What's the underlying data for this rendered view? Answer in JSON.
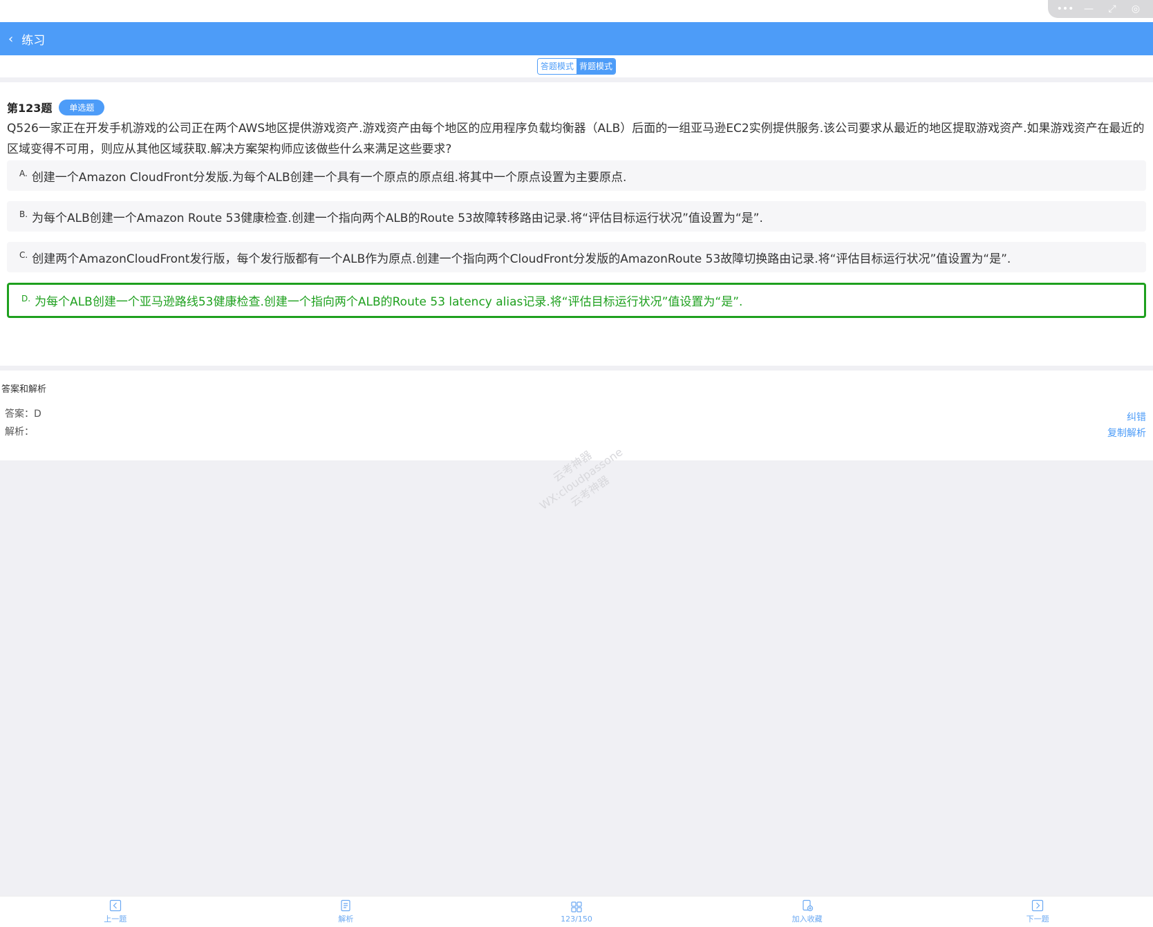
{
  "window_controls": {
    "more": "•••",
    "minimize": "—",
    "restore": "⤢",
    "close": "◎"
  },
  "navbar": {
    "back_icon": "‹",
    "title": "练习"
  },
  "modes": {
    "answer_mode": "答题模式",
    "memorize_mode": "背题模式",
    "active": "背题模式"
  },
  "question": {
    "number": "第123题",
    "type": "单选题",
    "text": "Q526一家正在开发手机游戏的公司正在两个AWS地区提供游戏资产.游戏资产由每个地区的应用程序负载均衡器（ALB）后面的一组亚马逊EC2实例提供服务.该公司要求从最近的地区提取游戏资产.如果游戏资产在最近的区域变得不可用，则应从其他区域获取.解决方案架构师应该做些什么来满足这些要求?",
    "options": [
      {
        "letter": "A.",
        "text": "创建一个Amazon CloudFront分发版.为每个ALB创建一个具有一个原点的原点组.将其中一个原点设置为主要原点."
      },
      {
        "letter": "B.",
        "text": "为每个ALB创建一个Amazon Route 53健康检查.创建一个指向两个ALB的Route 53故障转移路由记录.将“评估目标运行状况”值设置为“是”."
      },
      {
        "letter": "C.",
        "text": "创建两个AmazonCloudFront发行版，每个发行版都有一个ALB作为原点.创建一个指向两个CloudFront分发版的AmazonRoute 53故障切换路由记录.将“评估目标运行状况”值设置为“是”."
      },
      {
        "letter": "D.",
        "text": "为每个ALB创建一个亚马逊路线53健康检查.创建一个指向两个ALB的Route 53 latency alias记录.将“评估目标运行状况”值设置为“是”."
      }
    ]
  },
  "analysis": {
    "title": "答案和解析",
    "answer": "答案：D",
    "explanation": "解析：",
    "correct_link": "纠错",
    "copy_link": "复制解析"
  },
  "watermark": {
    "line1": "云考神器",
    "line2": "WX:cloudpassone",
    "line3": "云考神器"
  },
  "tabbar": {
    "prev": "上一题",
    "explain": "解析",
    "progress": "123/150",
    "favorite": "加入收藏",
    "next": "下一题"
  },
  "colors": {
    "primary": "#4d9cf8",
    "correct": "#1ea01e"
  }
}
